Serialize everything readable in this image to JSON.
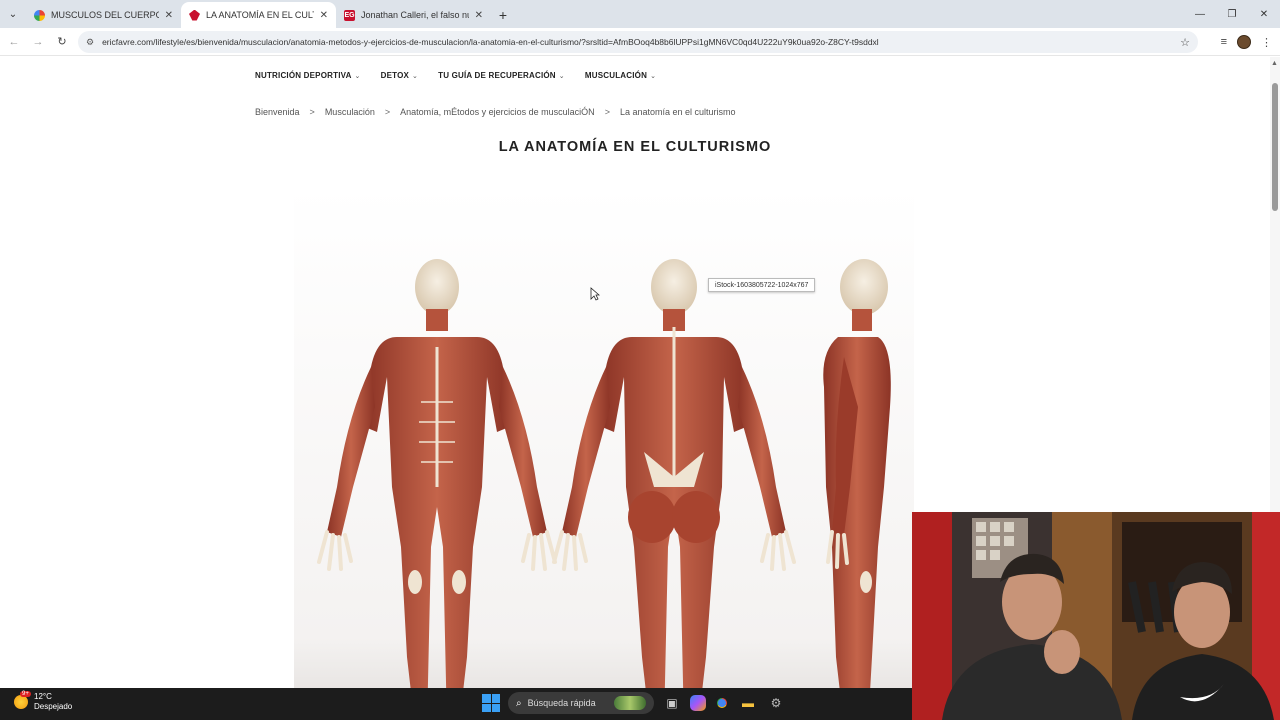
{
  "browser": {
    "tabs": [
      {
        "title": "MUSCULOS DEL CUERPO - Bus",
        "favicon": "google-favicon",
        "active": false
      },
      {
        "title": "LA ANATOMÍA EN EL CULTURIS",
        "favicon": "ericfavre-favicon",
        "active": true
      },
      {
        "title": "Jonathan Calleri, el falso nueve",
        "favicon": "eg-favicon",
        "active": false
      }
    ],
    "eg_favicon_text": "EG",
    "url": "ericfavre.com/lifestyle/es/bienvenida/musculacion/anatomia-metodos-y-ejercicios-de-musculacion/la-anatomia-en-el-culturismo/?srsltid=AfmBOoq4b8b6lUPPsi1gMN6VC0qd4U222uY9k0ua92o-Z8CY-t9sddxl"
  },
  "site": {
    "nav": [
      {
        "label": "NUTRICIÓN DEPORTIVA"
      },
      {
        "label": "DETOX"
      },
      {
        "label": "TU GUÍA DE RECUPERACIÓN"
      },
      {
        "label": "MUSCULACIÓN"
      }
    ],
    "breadcrumb": [
      "Bienvenida",
      "Musculación",
      "Anatomía, mÉtodos y ejercicios de musculaciÓN",
      "La anatomía en el culturismo"
    ],
    "breadcrumb_separator": ">",
    "page_title": "LA ANATOMÍA EN EL CULTURISMO",
    "image_tooltip": "iStock-1603805722-1024x767"
  },
  "taskbar": {
    "weather_temp": "12°C",
    "weather_desc": "Despejado",
    "weather_badge": "9+",
    "search_placeholder": "Búsqueda rápida"
  },
  "colors": {
    "muscle": "#b5533c",
    "muscle_dark": "#8c3426",
    "tendon": "#efe4d2",
    "taskbar": "#1c1c1c",
    "tabstrip": "#dde3ea"
  }
}
